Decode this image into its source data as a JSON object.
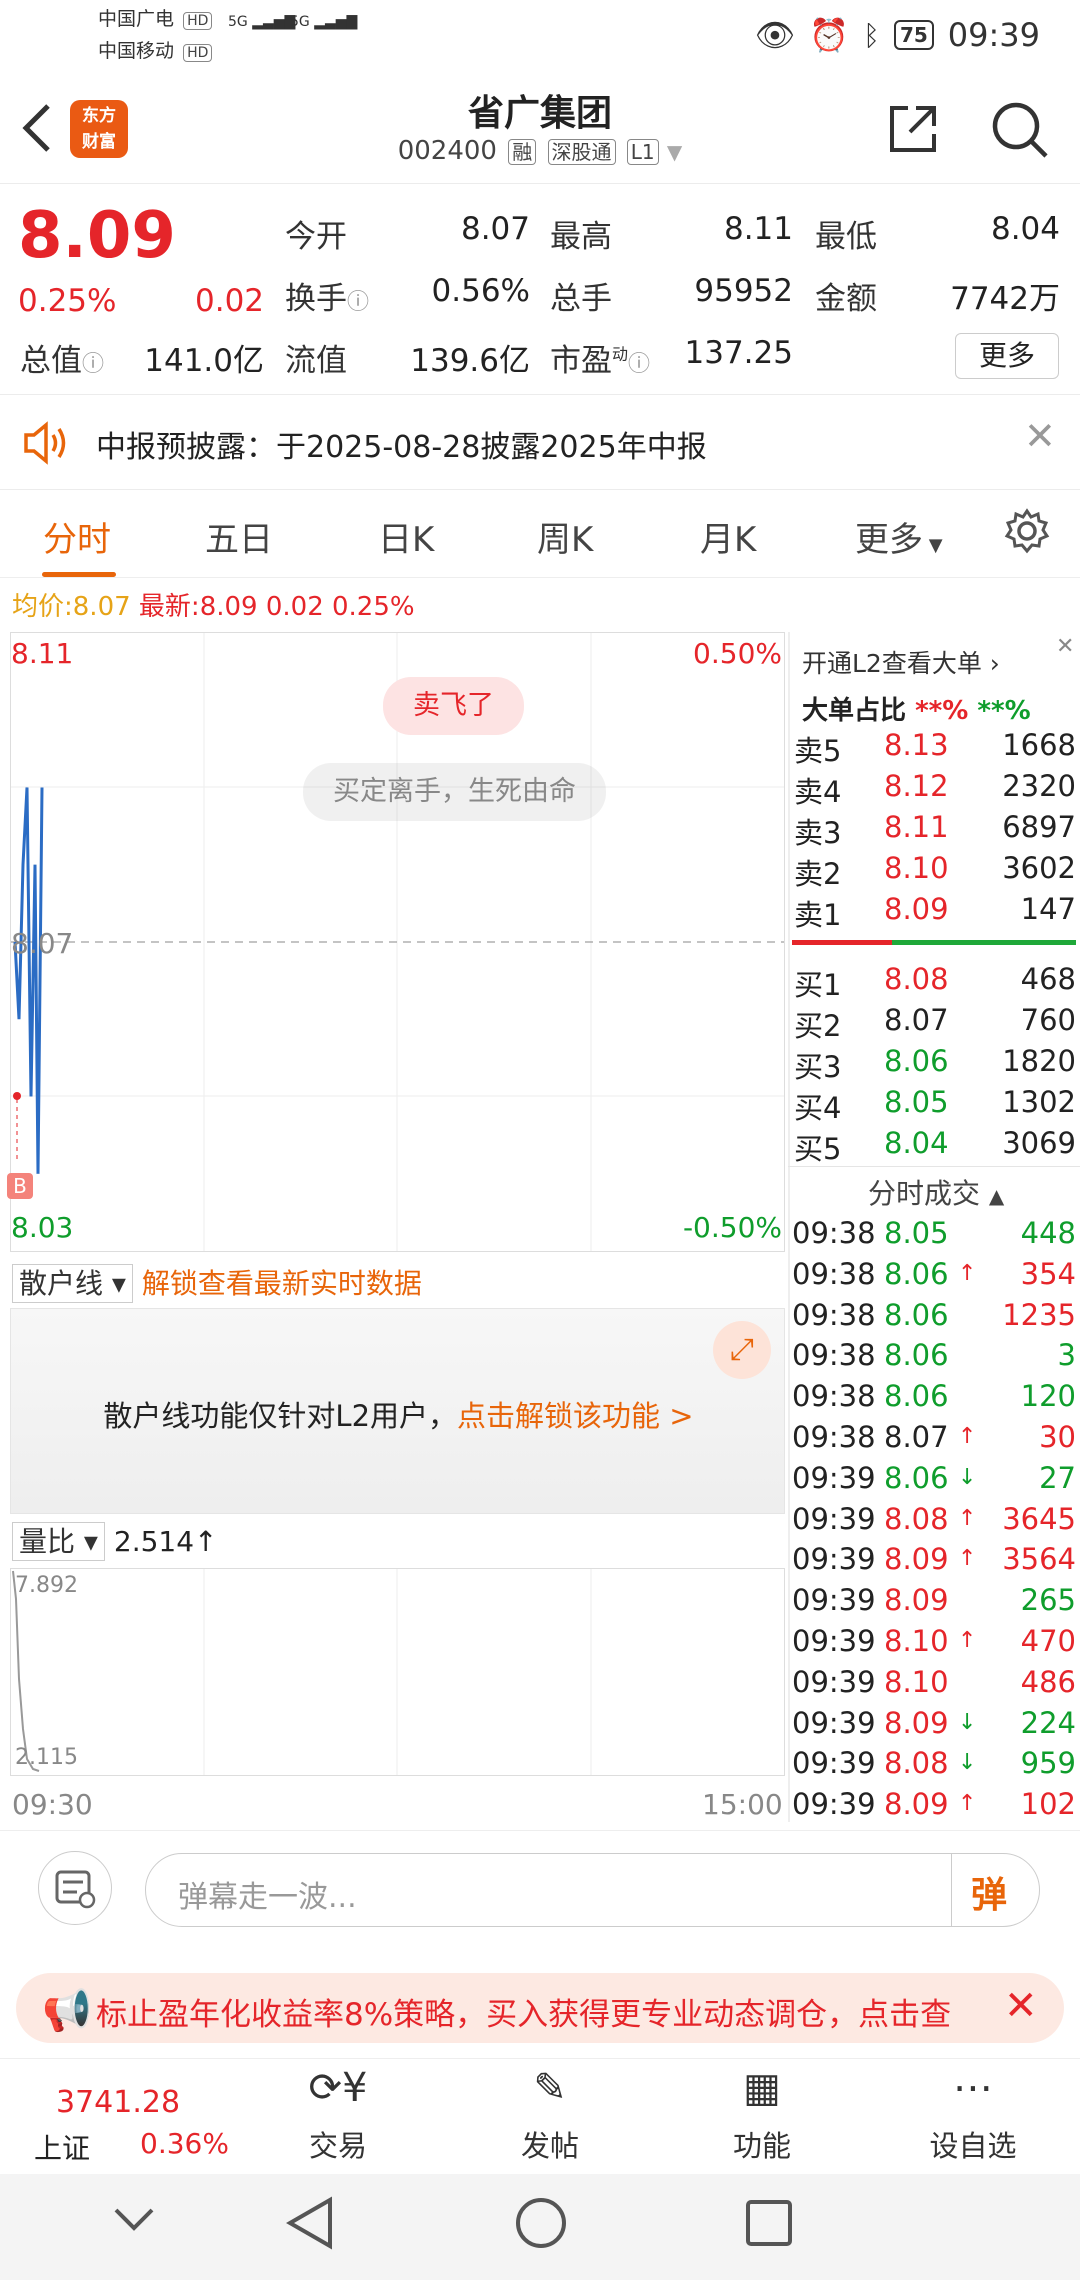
{
  "status_bar": {
    "carrier1": "中国广电",
    "carrier2": "中国移动",
    "hd": "HD",
    "net1": "5G",
    "net2": "5G",
    "battery": "75",
    "time": "09:39"
  },
  "header": {
    "logo_line1": "东方",
    "logo_line2": "财富",
    "title": "省广集团",
    "code": "002400",
    "tags": [
      "融",
      "深股通",
      "L1"
    ]
  },
  "quote": {
    "price": "8.09",
    "change_pct": "0.25%",
    "change": "0.02",
    "open_label": "今开",
    "open": "8.07",
    "high_label": "最高",
    "high": "8.11",
    "low_label": "最低",
    "low": "8.04",
    "turnover_label": "换手",
    "turnover": "0.56%",
    "volume_label": "总手",
    "volume": "95952",
    "amount_label": "金额",
    "amount": "7742万",
    "mktcap_label": "总值",
    "mktcap": "141.0亿",
    "float_label": "流值",
    "float": "139.6亿",
    "pe_label": "市盈",
    "pe_sup": "动",
    "pe": "137.25",
    "more_label": "更多"
  },
  "notice": {
    "text": "中报预披露：于2025-08-28披露2025年中报"
  },
  "tabs": [
    "分时",
    "五日",
    "日K",
    "周K",
    "月K",
    "更多"
  ],
  "avg_row": {
    "avg_label": "均价:",
    "avg": "8.07",
    "latest_label": "最新:",
    "latest": "8.09",
    "chg": "0.02",
    "pct": "0.25%"
  },
  "chart": {
    "y_max": "8.11",
    "y_min": "8.03",
    "pct_max": "0.50%",
    "pct_min": "-0.50%",
    "mid": "8.07",
    "bubble1": "卖飞了",
    "bubble2": "买定离手，生死由命",
    "b_marker": "B",
    "sanhu_label": "散户线",
    "sanhu_unlock": "解锁查看最新实时数据",
    "sanhu_msg": "散户线功能仅针对L2用户，",
    "sanhu_link": "点击解锁该功能 >",
    "liangbi_label": "量比",
    "liangbi_value": "2.514↑",
    "lb_max": "7.892",
    "lb_min": "2.115",
    "t_start": "09:30",
    "t_end": "15:00"
  },
  "chart_data": {
    "type": "line",
    "title": "",
    "series": [
      {
        "values": [
          8.07,
          8.06,
          8.08,
          8.09,
          8.05,
          8.08,
          8.04,
          8.09
        ]
      }
    ],
    "ylim": [
      8.03,
      8.11
    ]
  },
  "book": {
    "l2_label": "开通L2查看大单",
    "big_label": "大单占比",
    "big_v1": "**%",
    "big_v2": "**%",
    "asks": [
      {
        "label": "卖5",
        "price": "8.13",
        "vol": "1668",
        "color": "red"
      },
      {
        "label": "卖4",
        "price": "8.12",
        "vol": "2320",
        "color": "red"
      },
      {
        "label": "卖3",
        "price": "8.11",
        "vol": "6897",
        "color": "red"
      },
      {
        "label": "卖2",
        "price": "8.10",
        "vol": "3602",
        "color": "red"
      },
      {
        "label": "卖1",
        "price": "8.09",
        "vol": "147",
        "color": "red"
      }
    ],
    "bids": [
      {
        "label": "买1",
        "price": "8.08",
        "vol": "468",
        "color": "red"
      },
      {
        "label": "买2",
        "price": "8.07",
        "vol": "760",
        "color": "black"
      },
      {
        "label": "买3",
        "price": "8.06",
        "vol": "1820",
        "color": "green"
      },
      {
        "label": "买4",
        "price": "8.05",
        "vol": "1302",
        "color": "green"
      },
      {
        "label": "买5",
        "price": "8.04",
        "vol": "3069",
        "color": "green"
      }
    ],
    "ticks_label": "分时成交",
    "ticks": [
      {
        "t": "09:38",
        "p": "8.05",
        "v": "448",
        "pc": "green",
        "vc": "green",
        "arrow": ""
      },
      {
        "t": "09:38",
        "p": "8.06",
        "v": "354",
        "pc": "green",
        "vc": "red",
        "arrow": "↑"
      },
      {
        "t": "09:38",
        "p": "8.06",
        "v": "1235",
        "pc": "green",
        "vc": "red",
        "arrow": ""
      },
      {
        "t": "09:38",
        "p": "8.06",
        "v": "3",
        "pc": "green",
        "vc": "green",
        "arrow": ""
      },
      {
        "t": "09:38",
        "p": "8.06",
        "v": "120",
        "pc": "green",
        "vc": "green",
        "arrow": ""
      },
      {
        "t": "09:38",
        "p": "8.07",
        "v": "30",
        "pc": "black",
        "vc": "red",
        "arrow": "↑"
      },
      {
        "t": "09:39",
        "p": "8.06",
        "v": "27",
        "pc": "green",
        "vc": "green",
        "arrow": "↓"
      },
      {
        "t": "09:39",
        "p": "8.08",
        "v": "3645",
        "pc": "red",
        "vc": "red",
        "arrow": "↑"
      },
      {
        "t": "09:39",
        "p": "8.09",
        "v": "3564",
        "pc": "red",
        "vc": "red",
        "arrow": "↑"
      },
      {
        "t": "09:39",
        "p": "8.09",
        "v": "265",
        "pc": "red",
        "vc": "green",
        "arrow": ""
      },
      {
        "t": "09:39",
        "p": "8.10",
        "v": "470",
        "pc": "red",
        "vc": "red",
        "arrow": "↑"
      },
      {
        "t": "09:39",
        "p": "8.10",
        "v": "486",
        "pc": "red",
        "vc": "red",
        "arrow": ""
      },
      {
        "t": "09:39",
        "p": "8.09",
        "v": "224",
        "pc": "red",
        "vc": "green",
        "arrow": "↓"
      },
      {
        "t": "09:39",
        "p": "8.08",
        "v": "959",
        "pc": "red",
        "vc": "green",
        "arrow": "↓"
      },
      {
        "t": "09:39",
        "p": "8.09",
        "v": "102",
        "pc": "red",
        "vc": "red",
        "arrow": "↑"
      }
    ]
  },
  "comment": {
    "placeholder": "弹幕走一波...",
    "danmu": "弹"
  },
  "ad": {
    "text": "标止盈年化收益率8%策略，买入获得更专业动态调仓，点击查"
  },
  "bottom_nav": {
    "index_value": "3741.28",
    "index_name": "上证",
    "index_pct": "0.36%",
    "items": [
      "交易",
      "发帖",
      "功能",
      "设自选"
    ]
  }
}
